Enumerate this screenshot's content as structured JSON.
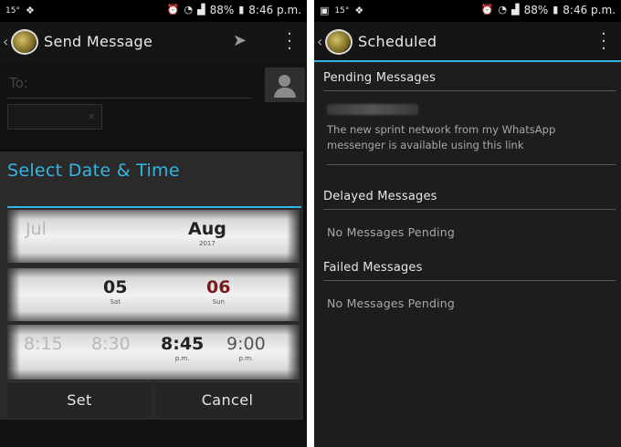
{
  "status": {
    "temp": "15°",
    "battery": "88%",
    "time": "8:46 p.m."
  },
  "left": {
    "title": "Send Message",
    "to_placeholder": "To:",
    "chip_close": "×",
    "dialog": {
      "title": "Select Date & Time",
      "month": {
        "prev": "Jul",
        "selected": "Aug",
        "year": "2017"
      },
      "day": {
        "selected": "05",
        "selected_dow": "Sat",
        "next": "06",
        "next_dow": "Sun"
      },
      "time": {
        "options": [
          {
            "value": "8:15",
            "ampm": ""
          },
          {
            "value": "8:30",
            "ampm": ""
          },
          {
            "value": "8:45",
            "ampm": "p.m."
          },
          {
            "value": "9:00",
            "ampm": "p.m."
          }
        ]
      },
      "set_label": "Set",
      "cancel_label": "Cancel"
    }
  },
  "right": {
    "title": "Scheduled",
    "pending": {
      "header": "Pending Messages",
      "message": "The new sprint network from my WhatsApp messenger is available using this link"
    },
    "delayed": {
      "header": "Delayed Messages",
      "empty": "No Messages Pending"
    },
    "failed": {
      "header": "Failed Messages",
      "empty": "No Messages Pending"
    }
  },
  "colors": {
    "accent": "#33b5e5",
    "background": "#1d1d1d"
  }
}
